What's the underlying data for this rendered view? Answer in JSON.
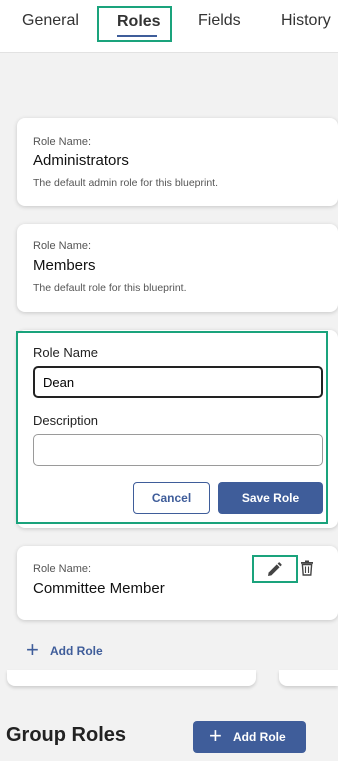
{
  "tabs": {
    "general": "General",
    "roles": "Roles",
    "fields": "Fields",
    "history": "History"
  },
  "roles": [
    {
      "label": "Role Name:",
      "name": "Administrators",
      "description": "The default admin role for this blueprint."
    },
    {
      "label": "Role Name:",
      "name": "Members",
      "description": "The default role for this blueprint."
    }
  ],
  "edit_form": {
    "name_label": "Role Name",
    "name_value": "Dean",
    "description_label": "Description",
    "description_value": "",
    "cancel_label": "Cancel",
    "save_label": "Save Role"
  },
  "committee_role": {
    "label": "Role Name:",
    "name": "Committee Member"
  },
  "add_role_label": "Add Role",
  "group_roles": {
    "title": "Group Roles",
    "add_button_label": "Add Role"
  },
  "colors": {
    "accent": "#3f5d9a",
    "highlight": "#1aa37c"
  },
  "icons": {
    "edit": "pencil-icon",
    "delete": "trash-icon",
    "add": "plus-icon"
  }
}
